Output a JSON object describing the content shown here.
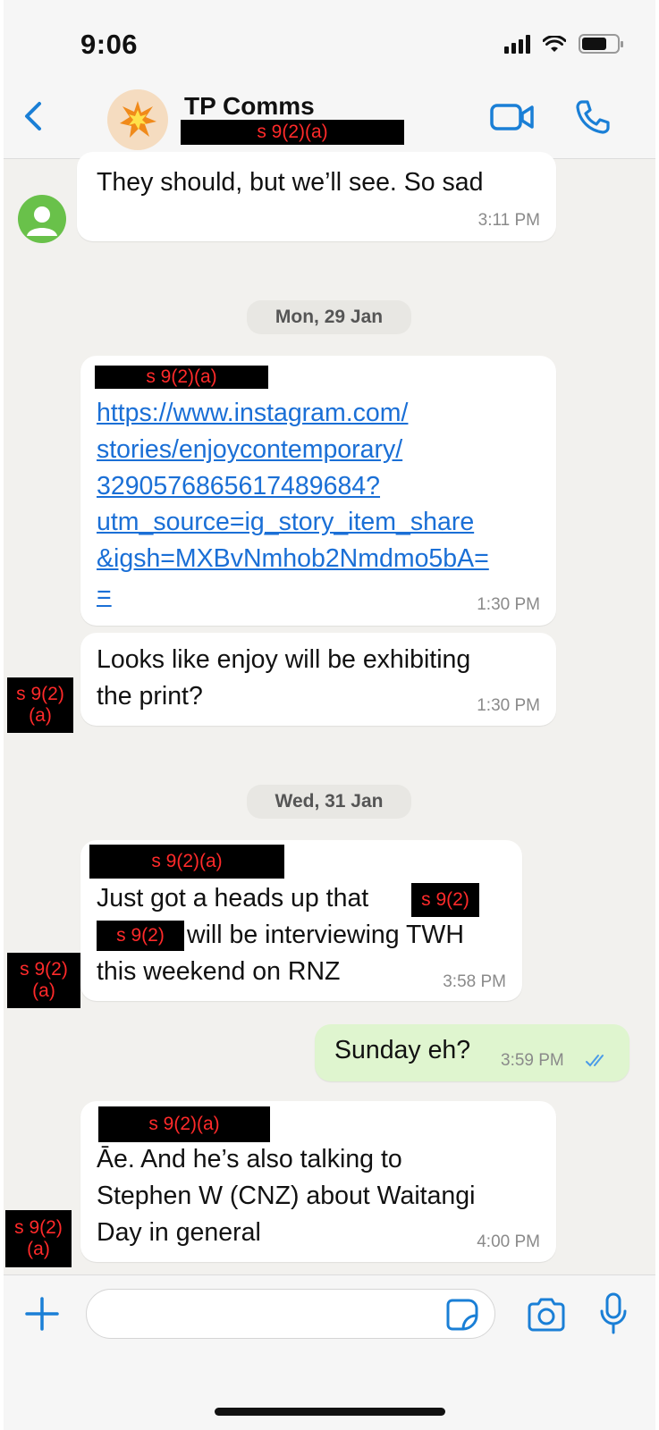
{
  "status": {
    "time": "9:06"
  },
  "header": {
    "title": "TP Comms",
    "redaction": "s 9(2)(a)"
  },
  "messages": {
    "m1": {
      "text": "They should, but we’ll see. So sad",
      "time": "3:11 PM"
    },
    "date1": "Mon, 29 Jan",
    "m2": {
      "redaction": "s 9(2)(a)",
      "link_lines": [
        "https://www.instagram.com/",
        "stories/enjoycontemporary/",
        "3290576865617489684?",
        "utm_source=ig_story_item_share",
        "&igsh=MXBvNmhob2Nmdmo5bA=",
        "="
      ],
      "time": "1:30 PM"
    },
    "m3": {
      "lines": [
        "Looks like enjoy will be exhibiting",
        "the print?"
      ],
      "time": "1:30 PM",
      "sender_redaction": [
        "s 9(2)",
        "(a)"
      ]
    },
    "date2": "Wed, 31 Jan",
    "m4": {
      "redaction": "s 9(2)(a)",
      "line1": "Just got a heads up that",
      "inline_redaction_1": "s 9(2)",
      "inline_redaction_2": "s 9(2)",
      "line2": "will be interviewing TWH",
      "line3": "this weekend on RNZ",
      "time": "3:58 PM",
      "sender_redaction": [
        "s 9(2)",
        "(a)"
      ]
    },
    "m5": {
      "text": "Sunday eh?",
      "time": "3:59 PM"
    },
    "m6": {
      "redaction": "s 9(2)(a)",
      "lines": [
        "Āe. And he’s also talking to",
        "Stephen W (CNZ) about Waitangi",
        "Day in general"
      ],
      "time": "4:00 PM",
      "sender_redaction": [
        "s 9(2)",
        "(a)"
      ]
    }
  },
  "composer": {
    "placeholder": ""
  },
  "icons": {
    "back": "chevron-left-icon",
    "video": "video-camera-icon",
    "phone": "phone-icon",
    "plus": "plus-icon",
    "sticker": "sticker-icon",
    "camera": "camera-icon",
    "mic": "microphone-icon"
  },
  "colors": {
    "accent": "#1a7fd6",
    "outgoing_bubble": "#dff5cf",
    "link": "#1a6fd6",
    "redaction_text": "#ff2a2a"
  }
}
